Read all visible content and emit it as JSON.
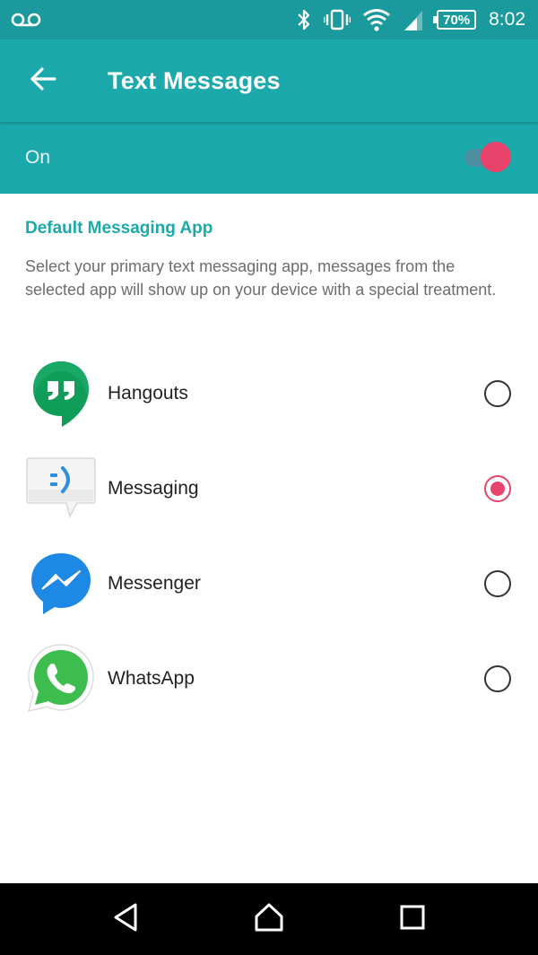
{
  "status_bar": {
    "left_icons": [
      "voicemail-icon"
    ],
    "right_icons": [
      "bluetooth-icon",
      "vibrate-icon",
      "wifi-icon",
      "cell-signal-icon",
      "battery-icon"
    ],
    "battery": "70%",
    "time": "8:02"
  },
  "app_bar": {
    "title": "Text Messages",
    "back_icon": "arrow-left-icon"
  },
  "toggle": {
    "label": "On",
    "state": "on"
  },
  "section": {
    "title": "Default Messaging App",
    "description": "Select your primary text messaging app, messages from the selected app will show up on your device with a special treatment."
  },
  "apps": [
    {
      "name": "Hangouts",
      "icon": "hangouts-icon",
      "selected": false
    },
    {
      "name": "Messaging",
      "icon": "messaging-icon",
      "selected": true
    },
    {
      "name": "Messenger",
      "icon": "messenger-icon",
      "selected": false
    },
    {
      "name": "WhatsApp",
      "icon": "whatsapp-icon",
      "selected": false
    }
  ],
  "nav_bar": {
    "icons": [
      "back-triangle-icon",
      "home-icon",
      "recents-icon"
    ]
  },
  "colors": {
    "status_bar": "#1a9a9c",
    "app_bar": "#1ca9ab",
    "accent": "#e8436a",
    "section_title": "#1ca9ab"
  }
}
